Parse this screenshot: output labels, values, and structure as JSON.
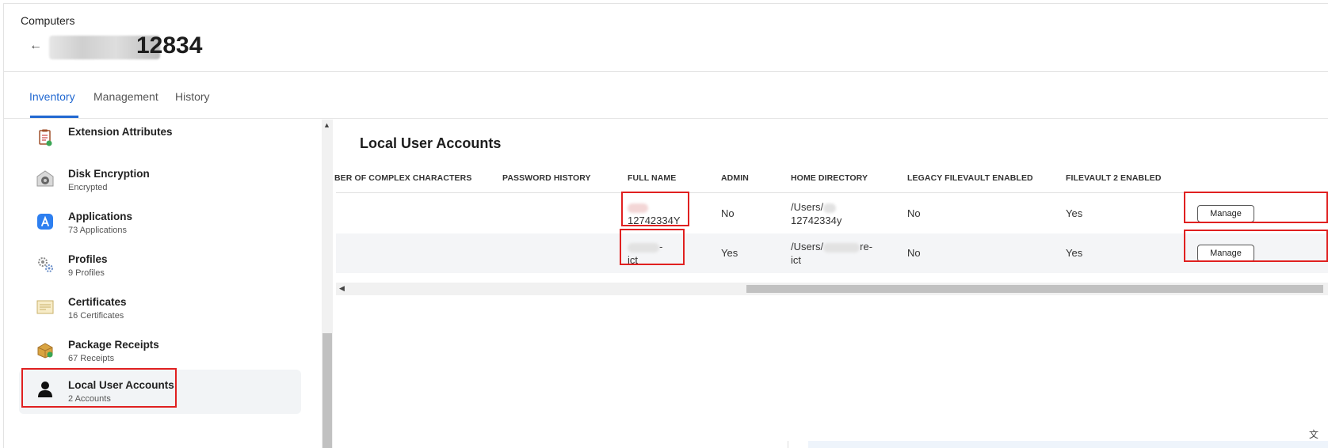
{
  "header": {
    "breadcrumb": "Computers",
    "title_visible": "12834"
  },
  "tabs": [
    {
      "label": "Inventory",
      "active": true
    },
    {
      "label": "Management",
      "active": false
    },
    {
      "label": "History",
      "active": false
    }
  ],
  "sidebar": {
    "items": [
      {
        "label": "Extension Attributes",
        "sub": "",
        "icon": "clipboard-checklist-icon"
      },
      {
        "label": "Disk Encryption",
        "sub": "Encrypted",
        "icon": "disk-lock-icon"
      },
      {
        "label": "Applications",
        "sub": "73 Applications",
        "icon": "app-store-icon"
      },
      {
        "label": "Profiles",
        "sub": "9 Profiles",
        "icon": "gears-icon"
      },
      {
        "label": "Certificates",
        "sub": "16 Certificates",
        "icon": "certificate-icon"
      },
      {
        "label": "Package Receipts",
        "sub": "67 Receipts",
        "icon": "package-icon"
      },
      {
        "label": "Local User Accounts",
        "sub": "2 Accounts",
        "icon": "user-silhouette-icon",
        "active": true
      }
    ]
  },
  "main": {
    "title": "Local User Accounts",
    "columns": [
      "BER OF COMPLEX CHARACTERS",
      "PASSWORD HISTORY",
      "FULL NAME",
      "ADMIN",
      "HOME DIRECTORY",
      "LEGACY FILEVAULT ENABLED",
      "FILEVAULT 2 ENABLED"
    ],
    "rows": [
      {
        "complex_chars": "",
        "password_history": "",
        "full_name_line2": "12742334Y",
        "admin": "No",
        "home_dir_line1": "/Users/",
        "home_dir_line2": "12742334y",
        "legacy_filevault": "No",
        "filevault2": "Yes",
        "action": "Manage"
      },
      {
        "complex_chars": "",
        "password_history": "",
        "full_name_line1": "-",
        "full_name_line2": "ict",
        "admin": "Yes",
        "home_dir_line1": "/Users/",
        "home_dir_suffix": "re-",
        "home_dir_line2": "ict",
        "legacy_filevault": "No",
        "filevault2": "Yes",
        "action": "Manage"
      }
    ]
  },
  "colors": {
    "accent": "#2168d1",
    "highlight_box": "#e02020",
    "active_item_bg": "#f2f4f6"
  }
}
